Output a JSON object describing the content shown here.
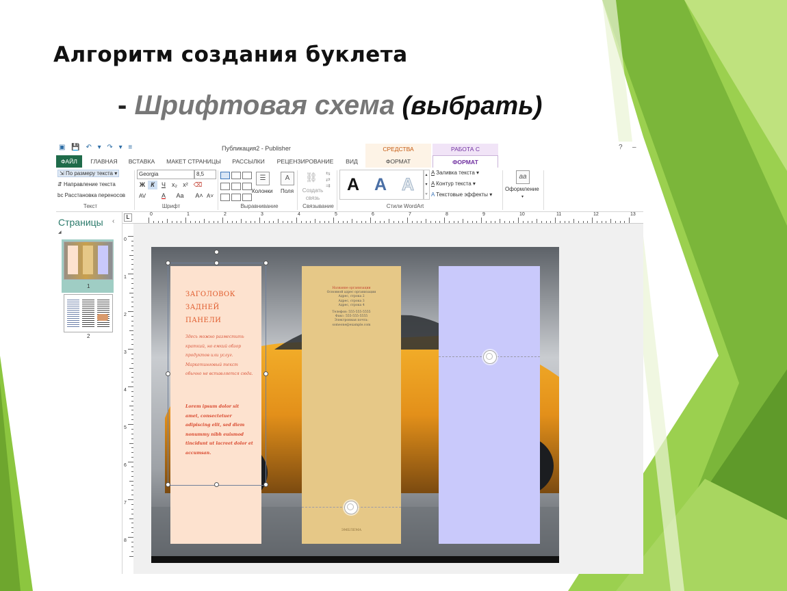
{
  "slide": {
    "title": "Алгоритм создания буклета",
    "subtitle_dash": "- ",
    "subtitle_main": "Шрифтовая схема",
    "subtitle_hint": " (выбрать)"
  },
  "window": {
    "title": "Публикация2 - Publisher",
    "context_draw": "СРЕДСТВА РИСОВАНИЯ",
    "context_text": "РАБОТА С НАДПИСЯМИ",
    "help": "?",
    "minimize": "–"
  },
  "tabs": {
    "file": "ФАЙЛ",
    "home": "ГЛАВНАЯ",
    "insert": "ВСТАВКА",
    "layout": "МАКЕТ СТРАНИЦЫ",
    "mailings": "РАССЫЛКИ",
    "review": "РЕЦЕНЗИРОВАНИЕ",
    "view": "ВИД",
    "format_draw": "ФОРМАТ",
    "format_text": "ФОРМАТ"
  },
  "ribbon": {
    "text_group": {
      "fit_text": "По размеру текста",
      "direction": "Направление текста",
      "hyphenation": "Расстановка переносов",
      "label": "Текст"
    },
    "font_group": {
      "font_name": "Georgia",
      "font_size": "8,5",
      "bold": "Ж",
      "italic": "К",
      "underline": "Ч",
      "subscript": "x₂",
      "superscript": "x²",
      "spacing": "AV",
      "font_color": "A",
      "case": "Aa",
      "grow": "A˄",
      "shrink": "A˅",
      "label": "Шрифт"
    },
    "align_group": {
      "columns": "Колонки",
      "margins": "Поля",
      "label": "Выравнивание"
    },
    "link_group": {
      "create_link": "Создать связь",
      "label": "Связывание"
    },
    "wordart_group": {
      "fill": "Заливка текста",
      "outline": "Контур текста",
      "effects": "Текстовые эффекты",
      "label": "Стили WordArt",
      "sample": "A"
    },
    "design_group": {
      "label": "Оформление",
      "icon_text": "aa"
    }
  },
  "pages_pane": {
    "title": "Страницы",
    "collapse": "‹",
    "expand": "◢",
    "page1": "1",
    "page2": "2"
  },
  "rulers": {
    "horizontal": [
      "0",
      "1",
      "2",
      "3",
      "4",
      "5",
      "6",
      "7",
      "8",
      "9",
      "10",
      "11",
      "12",
      "13"
    ],
    "vertical": [
      "0",
      "1",
      "2",
      "3",
      "4",
      "5",
      "6",
      "7",
      "8"
    ],
    "corner": "L"
  },
  "brochure": {
    "panel1": {
      "heading_1": "ЗАГОЛОВОК",
      "heading_2": "ЗАДНЕЙ",
      "heading_3": "ПАНЕЛИ",
      "body": "Здесь можно разместить краткий, но емкий обзор продуктов или услуг. Маркетинговый текст обычно не вставляется сюда.",
      "lorem": "Lorem ipsum dolor sit amet, consectetuer adipiscing elit, sed diem nonummy nibh euismod tincidunt ut lacreet dolor et accumsan."
    },
    "panel2": {
      "org": "Название организации",
      "address": "Основной адрес организации",
      "line2": "Адрес, строка 2",
      "line3": "Адрес, строка 3",
      "line4": "Адрес, строка 4",
      "phone": "Телефон: 555-555-5555",
      "fax": "Факс: 555-555-5555",
      "email_label": "Электронная почта:",
      "email": "someone@example.com",
      "logo": "ЭМБЛЕМА"
    }
  },
  "colors": {
    "panel1_bg": "#fde2cf",
    "panel2_bg": "#e6c887",
    "panel3_bg": "#c9c9fb",
    "file_tab": "#1f6b4a",
    "accent_green": "#8cc63f"
  }
}
